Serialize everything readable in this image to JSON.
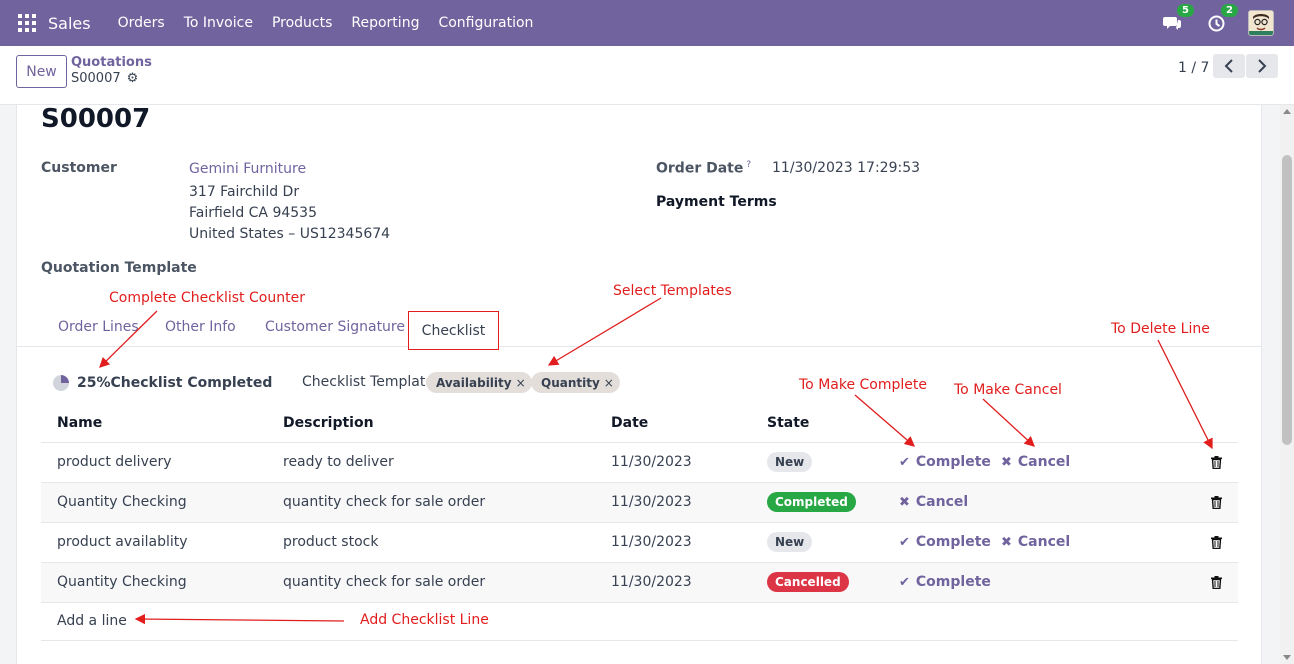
{
  "navbar": {
    "brand": "Sales",
    "menu": [
      "Orders",
      "To Invoice",
      "Products",
      "Reporting",
      "Configuration"
    ],
    "messages_count": "5",
    "activities_count": "2",
    "icons": [
      "apps-grid-icon",
      "chat-icon",
      "clock-icon",
      "user-avatar"
    ]
  },
  "control_panel": {
    "new_button": "New",
    "breadcrumb_parent": "Quotations",
    "breadcrumb_current": "S00007",
    "pager": "1 / 7"
  },
  "form": {
    "title": "S00007",
    "customer_label": "Customer",
    "customer_name": "Gemini Furniture",
    "address_line1": "317 Fairchild Dr",
    "address_line2": "Fairfield CA 94535",
    "address_line3": "United States – US12345674",
    "order_date_label": "Order Date",
    "order_date_help": "?",
    "order_date_value": "11/30/2023 17:29:53",
    "payment_terms_label": "Payment Terms",
    "quotation_template_label": "Quotation Template"
  },
  "tabs": [
    {
      "label": "Order Lines",
      "active": false
    },
    {
      "label": "Other Info",
      "active": false
    },
    {
      "label": "Customer Signature",
      "active": false
    },
    {
      "label": "Checklist",
      "active": true
    }
  ],
  "checklist": {
    "progress_percent": 25,
    "progress_text": "25%Checklist Completed",
    "template_label": "Checklist Template",
    "templates": [
      "Availability",
      "Quantity"
    ],
    "columns": [
      "Name",
      "Description",
      "Date",
      "State"
    ],
    "rows": [
      {
        "name": "product delivery",
        "description": "ready to deliver",
        "date": "11/30/2023",
        "state": "New",
        "actions": [
          "Complete",
          "Cancel"
        ]
      },
      {
        "name": "Quantity Checking",
        "description": "quantity check for sale order",
        "date": "11/30/2023",
        "state": "Completed",
        "actions": [
          "Cancel"
        ]
      },
      {
        "name": "product availablity",
        "description": "product stock",
        "date": "11/30/2023",
        "state": "New",
        "actions": [
          "Complete",
          "Cancel"
        ]
      },
      {
        "name": "Quantity Checking",
        "description": "quantity check for sale order",
        "date": "11/30/2023",
        "state": "Cancelled",
        "actions": [
          "Complete"
        ]
      }
    ],
    "add_line": "Add a line"
  },
  "annotations": {
    "counter": "Complete Checklist Counter",
    "select_templates": "Select Templates",
    "delete_line": "To Delete Line",
    "make_complete": "To Make Complete",
    "make_cancel": "To Make Cancel",
    "add_line": "Add Checklist Line"
  },
  "colors": {
    "brand": "#71639e",
    "annotation": "#e11d1d",
    "completed": "#28a745",
    "cancelled": "#dc3545"
  }
}
